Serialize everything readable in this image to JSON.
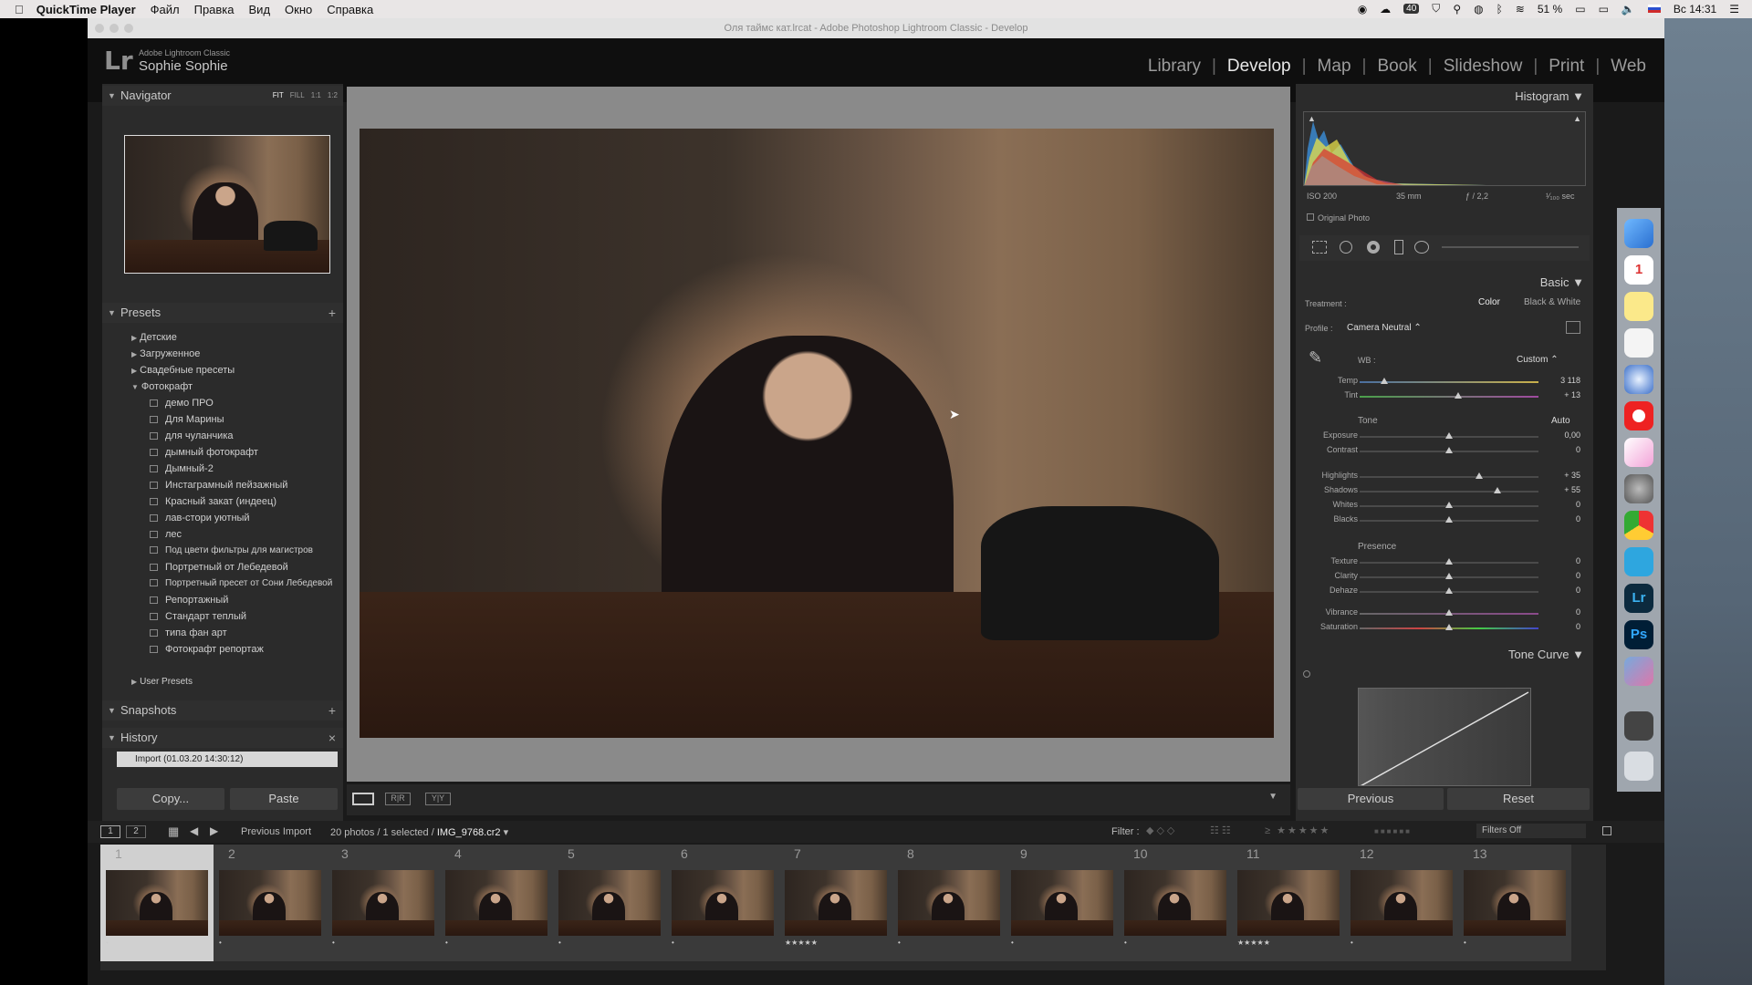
{
  "menubar": {
    "app": "QuickTime Player",
    "items": [
      "Файл",
      "Правка",
      "Вид",
      "Окно",
      "Справка"
    ],
    "battery": "51 %",
    "clock": "Вс 14:31",
    "badge": "40"
  },
  "window": {
    "title": "Оля таймс кат.lrcat - Adobe Photoshop Lightroom Classic - Develop"
  },
  "identity": {
    "logo": "Lr",
    "product": "Adobe Lightroom Classic",
    "user": "Sophie Sophie"
  },
  "modules": [
    "Library",
    "Develop",
    "Map",
    "Book",
    "Slideshow",
    "Print",
    "Web"
  ],
  "active_module": "Develop",
  "left": {
    "navigator": {
      "title": "Navigator",
      "zoom": [
        "FIT",
        "FILL",
        "1:1",
        "1:2"
      ]
    },
    "presets": {
      "title": "Presets",
      "groups": [
        "Детские",
        "Загруженное",
        "Свадебные пресеты",
        "Фотокрафт"
      ],
      "items": [
        "демо ПРО",
        "Для Марины",
        "для чуланчика",
        "дымный фотокрафт",
        "Дымный-2",
        "Инстаграмный пейзажный",
        "Красный закат (индеец)",
        "лав-стори уютный",
        "лес",
        "Под цвети фильтры для магистров",
        "Портретный от Лебедевой",
        "Портретный пресет от Сони Лебедевой",
        "Репортажный",
        "Стандарт теплый",
        "типа фан арт",
        "Фотокрафт репортаж"
      ],
      "user_presets": "User Presets"
    },
    "snapshots": {
      "title": "Snapshots"
    },
    "history": {
      "title": "History",
      "item": "Import (01.03.20 14:30:12)"
    },
    "copy_button": "Copy...",
    "paste_button": "Paste"
  },
  "right": {
    "histogram": {
      "title": "Histogram",
      "iso": "ISO 200",
      "focal": "35 mm",
      "aperture": "ƒ / 2,2",
      "shutter": "¹⁄₁₀₀ sec",
      "original_photo": "Original Photo"
    },
    "basic": {
      "title": "Basic",
      "treatment_label": "Treatment :",
      "treatment_color": "Color",
      "treatment_bw": "Black & White",
      "profile_label": "Profile :",
      "profile_value": "Camera Neutral",
      "wb_label": "WB :",
      "wb_value": "Custom",
      "tone_label": "Tone",
      "auto_label": "Auto",
      "presence_label": "Presence",
      "sliders": [
        {
          "name": "Temp",
          "value": "3 118",
          "pos": 0.14
        },
        {
          "name": "Tint",
          "value": "+ 13",
          "pos": 0.55
        },
        {
          "name": "Exposure",
          "value": "0,00",
          "pos": 0.5
        },
        {
          "name": "Contrast",
          "value": "0",
          "pos": 0.5
        },
        {
          "name": "Highlights",
          "value": "+ 35",
          "pos": 0.67
        },
        {
          "name": "Shadows",
          "value": "+ 55",
          "pos": 0.77
        },
        {
          "name": "Whites",
          "value": "0",
          "pos": 0.5
        },
        {
          "name": "Blacks",
          "value": "0",
          "pos": 0.5
        },
        {
          "name": "Texture",
          "value": "0",
          "pos": 0.5
        },
        {
          "name": "Clarity",
          "value": "0",
          "pos": 0.5
        },
        {
          "name": "Dehaze",
          "value": "0",
          "pos": 0.5
        },
        {
          "name": "Vibrance",
          "value": "0",
          "pos": 0.5
        },
        {
          "name": "Saturation",
          "value": "0",
          "pos": 0.5
        }
      ]
    },
    "tone_curve": {
      "title": "Tone Curve"
    },
    "previous_button": "Previous",
    "reset_button": "Reset"
  },
  "filmbar": {
    "source": "Previous Import",
    "info": "20 photos / 1 selected / ",
    "filename": "IMG_9768.cr2",
    "filter_label": "Filter :",
    "filters_value": "Filters Off"
  },
  "filmstrip": {
    "cells": [
      {
        "num": "1",
        "stars": "•",
        "selected": true
      },
      {
        "num": "2",
        "stars": "•"
      },
      {
        "num": "3",
        "stars": "•"
      },
      {
        "num": "4",
        "stars": "•"
      },
      {
        "num": "5",
        "stars": "•"
      },
      {
        "num": "6",
        "stars": "•"
      },
      {
        "num": "7",
        "stars": "★★★★★"
      },
      {
        "num": "8",
        "stars": "•"
      },
      {
        "num": "9",
        "stars": "•"
      },
      {
        "num": "10",
        "stars": "•"
      },
      {
        "num": "11",
        "stars": "★★★★★"
      },
      {
        "num": "12",
        "stars": "•"
      },
      {
        "num": "13",
        "stars": "•"
      }
    ]
  },
  "dock": {
    "calendar_day": "1",
    "lr_icon": "Lr",
    "ps_icon": "Ps"
  }
}
